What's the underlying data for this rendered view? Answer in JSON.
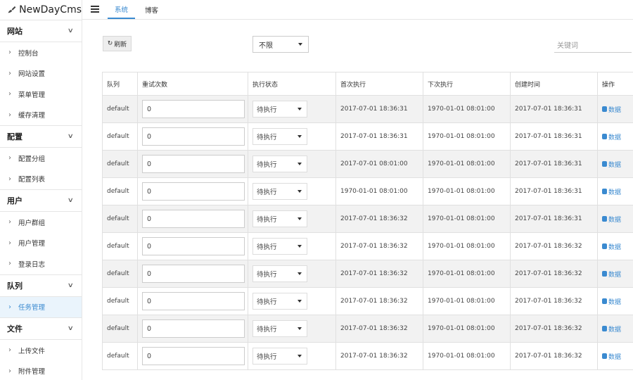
{
  "brand": {
    "name": "NewDayCms"
  },
  "topbar": {
    "tabs": [
      {
        "label": "系统",
        "active": true
      },
      {
        "label": "博客",
        "active": false
      }
    ]
  },
  "sidebar": {
    "sections": [
      {
        "title": "网站",
        "items": [
          "控制台",
          "网站设置",
          "菜单管理",
          "缓存清理"
        ]
      },
      {
        "title": "配置",
        "items": [
          "配置分组",
          "配置列表"
        ]
      },
      {
        "title": "用户",
        "items": [
          "用户群组",
          "用户管理",
          "登录日志"
        ]
      },
      {
        "title": "队列",
        "items": [
          "任务管理"
        ]
      },
      {
        "title": "文件",
        "items": [
          "上传文件",
          "附件管理"
        ]
      }
    ],
    "active_item": "任务管理"
  },
  "toolbar": {
    "refresh_label": "刷新",
    "filter_value": "不限",
    "search_placeholder": "关键词"
  },
  "table": {
    "headers": [
      "队列",
      "重试次数",
      "执行状态",
      "首次执行",
      "下次执行",
      "创建时间",
      "操作"
    ],
    "rows": [
      {
        "queue": "default",
        "retries": "0",
        "status": "待执行",
        "first": "2017-07-01 18:36:31",
        "next": "1970-01-01 08:01:00",
        "created": "2017-07-01 18:36:31",
        "action": "数据"
      },
      {
        "queue": "default",
        "retries": "0",
        "status": "待执行",
        "first": "2017-07-01 18:36:31",
        "next": "1970-01-01 08:01:00",
        "created": "2017-07-01 18:36:31",
        "action": "数据"
      },
      {
        "queue": "default",
        "retries": "0",
        "status": "待执行",
        "first": "2017-07-01 08:01:00",
        "next": "1970-01-01 08:01:00",
        "created": "2017-07-01 18:36:31",
        "action": "数据"
      },
      {
        "queue": "default",
        "retries": "0",
        "status": "待执行",
        "first": "1970-01-01 08:01:00",
        "next": "1970-01-01 08:01:00",
        "created": "2017-07-01 18:36:31",
        "action": "数据"
      },
      {
        "queue": "default",
        "retries": "0",
        "status": "待执行",
        "first": "2017-07-01 18:36:32",
        "next": "1970-01-01 08:01:00",
        "created": "2017-07-01 18:36:31",
        "action": "数据"
      },
      {
        "queue": "default",
        "retries": "0",
        "status": "待执行",
        "first": "2017-07-01 18:36:32",
        "next": "1970-01-01 08:01:00",
        "created": "2017-07-01 18:36:32",
        "action": "数据"
      },
      {
        "queue": "default",
        "retries": "0",
        "status": "待执行",
        "first": "2017-07-01 18:36:32",
        "next": "1970-01-01 08:01:00",
        "created": "2017-07-01 18:36:32",
        "action": "数据"
      },
      {
        "queue": "default",
        "retries": "0",
        "status": "待执行",
        "first": "2017-07-01 18:36:32",
        "next": "1970-01-01 08:01:00",
        "created": "2017-07-01 18:36:32",
        "action": "数据"
      },
      {
        "queue": "default",
        "retries": "0",
        "status": "待执行",
        "first": "2017-07-01 18:36:32",
        "next": "1970-01-01 08:01:00",
        "created": "2017-07-01 18:36:32",
        "action": "数据"
      },
      {
        "queue": "default",
        "retries": "0",
        "status": "待执行",
        "first": "2017-07-01 18:36:32",
        "next": "1970-01-01 08:01:00",
        "created": "2017-07-01 18:36:32",
        "action": "数据"
      }
    ]
  },
  "colors": {
    "accent": "#3a8ad0",
    "stripe": "#f2f2f2",
    "border": "#e0e0e0"
  },
  "icons": {
    "brand": "brush-logo-icon",
    "menu": "hamburger-icon",
    "refresh": "refresh-icon",
    "action": "database-icon"
  }
}
